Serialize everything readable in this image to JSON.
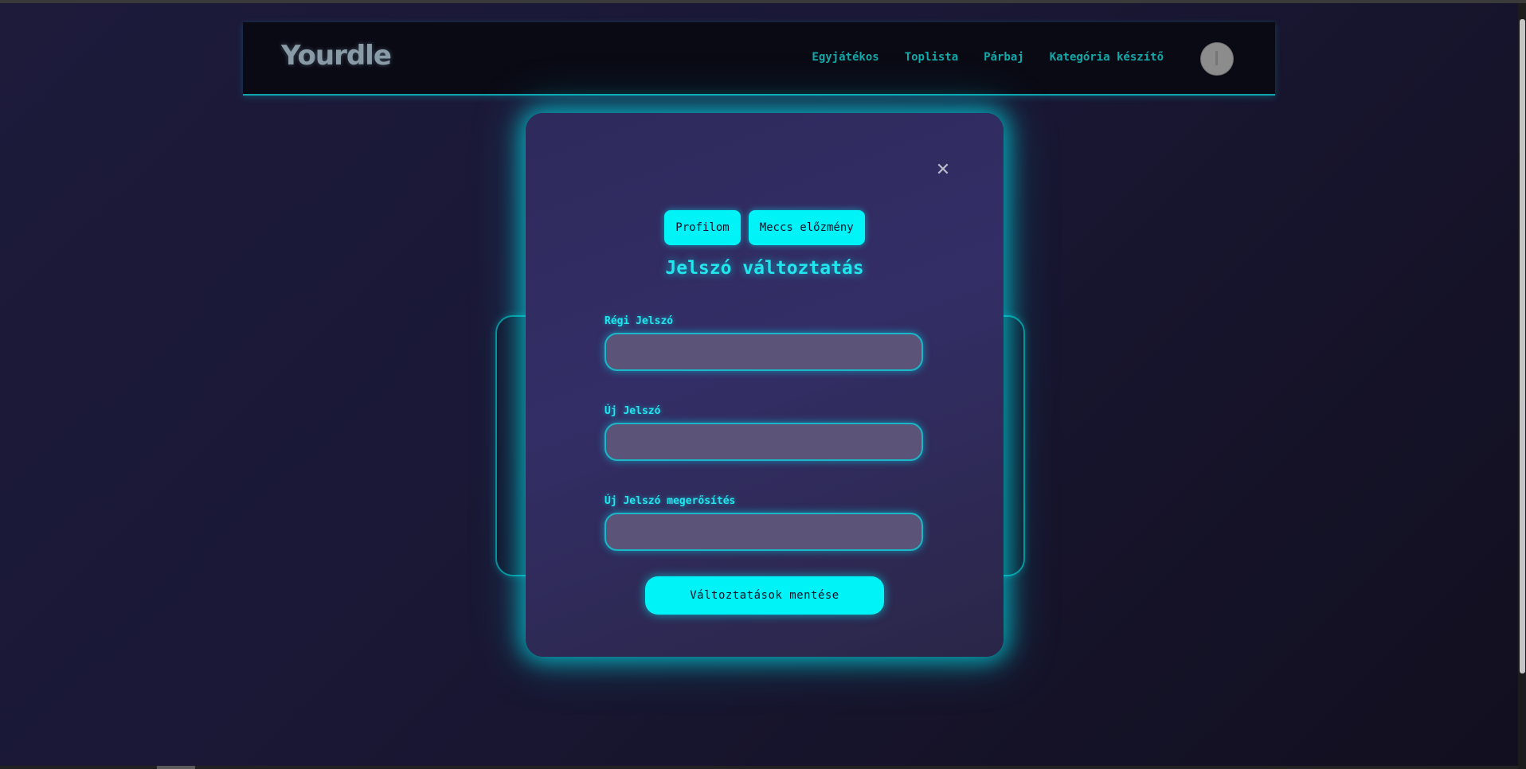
{
  "app": {
    "logo_text": "Yourdle"
  },
  "nav": {
    "items": [
      {
        "label": "Egyjátékos"
      },
      {
        "label": "Toplista"
      },
      {
        "label": "Párbaj"
      },
      {
        "label": "Kategória készítő"
      }
    ],
    "avatar_icon": "user-avatar-icon"
  },
  "modal": {
    "close_icon": "close-icon",
    "tabs": [
      {
        "label": "Profilom"
      },
      {
        "label": "Meccs előzmény"
      }
    ],
    "title": "Jelszó változtatás",
    "fields": {
      "old_password": {
        "label": "Régi Jelszó",
        "value": ""
      },
      "new_password": {
        "label": "Új Jelszó",
        "value": ""
      },
      "confirm_password": {
        "label": "Új Jelszó megerősítés",
        "value": ""
      }
    },
    "save_label": "Változtatások mentése"
  },
  "colors": {
    "accent": "#00f3f6",
    "nav_link": "#11a9a9",
    "background": "#1a1836",
    "modal_bg": "#2e2a5c",
    "input_bg": "#5b5478"
  }
}
